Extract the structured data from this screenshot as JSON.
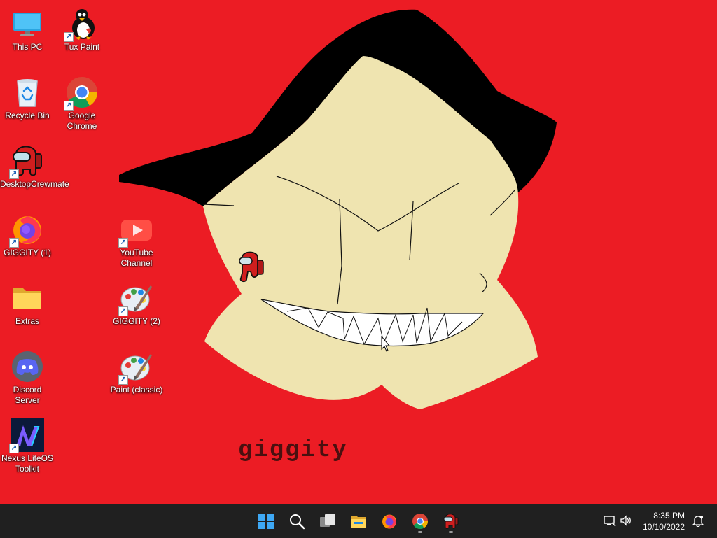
{
  "desktop": {
    "icons": [
      {
        "label": "This PC",
        "icon": "monitor-icon"
      },
      {
        "label": "Tux Paint",
        "icon": "tux-penguin-icon"
      },
      {
        "label": "Recycle Bin",
        "icon": "recycle-bin-icon"
      },
      {
        "label": "Google Chrome",
        "icon": "chrome-icon"
      },
      {
        "label": "DesktopCrewmate",
        "icon": "crewmate-icon"
      },
      {
        "label": "GIGGITY (1)",
        "icon": "firefox-icon"
      },
      {
        "label": "YouTube Channel",
        "icon": "youtube-icon"
      },
      {
        "label": "Extras",
        "icon": "folder-icon"
      },
      {
        "label": "GIGGITY (2)",
        "icon": "paint-palette-icon"
      },
      {
        "label": "Discord Server",
        "icon": "discord-icon"
      },
      {
        "label": "Paint (classic)",
        "icon": "paint-palette-icon"
      },
      {
        "label": "Nexus LiteOS Toolkit",
        "icon": "nexus-toolkit-icon"
      }
    ]
  },
  "wallpaper": {
    "caption": "giggity",
    "colors": {
      "background": "#ec1c24",
      "face": "#efe4b0",
      "hat": "#000000",
      "teeth": "#ffffff"
    }
  },
  "taskbar": {
    "apps": [
      {
        "name": "Start",
        "icon": "windows-start-icon",
        "running": false
      },
      {
        "name": "Search",
        "icon": "search-icon",
        "running": false
      },
      {
        "name": "Task View",
        "icon": "task-view-icon",
        "running": false
      },
      {
        "name": "File Explorer",
        "icon": "file-explorer-icon",
        "running": false
      },
      {
        "name": "Firefox",
        "icon": "firefox-icon",
        "running": false
      },
      {
        "name": "Google Chrome",
        "icon": "chrome-icon",
        "running": true
      },
      {
        "name": "DesktopCrewmate",
        "icon": "crewmate-icon",
        "running": true
      }
    ],
    "tray": {
      "time": "8:35 PM",
      "date": "10/10/2022"
    },
    "colors": {
      "taskbar": "#202020",
      "accent": "#0078d4"
    }
  }
}
